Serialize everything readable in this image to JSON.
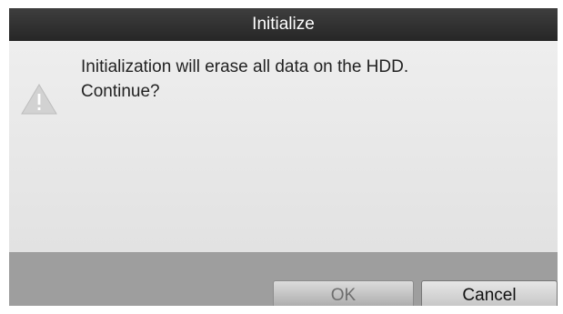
{
  "dialog": {
    "title": "Initialize",
    "icon": "warning-triangle-icon",
    "message_line1": "Initialization will erase all data on the HDD.",
    "message_line2": "Continue?",
    "buttons": {
      "ok_label": "OK",
      "cancel_label": "Cancel"
    }
  },
  "colors": {
    "titlebar": "#2f2f2f",
    "body": "#e8e8e8",
    "footer": "#9e9e9e"
  }
}
